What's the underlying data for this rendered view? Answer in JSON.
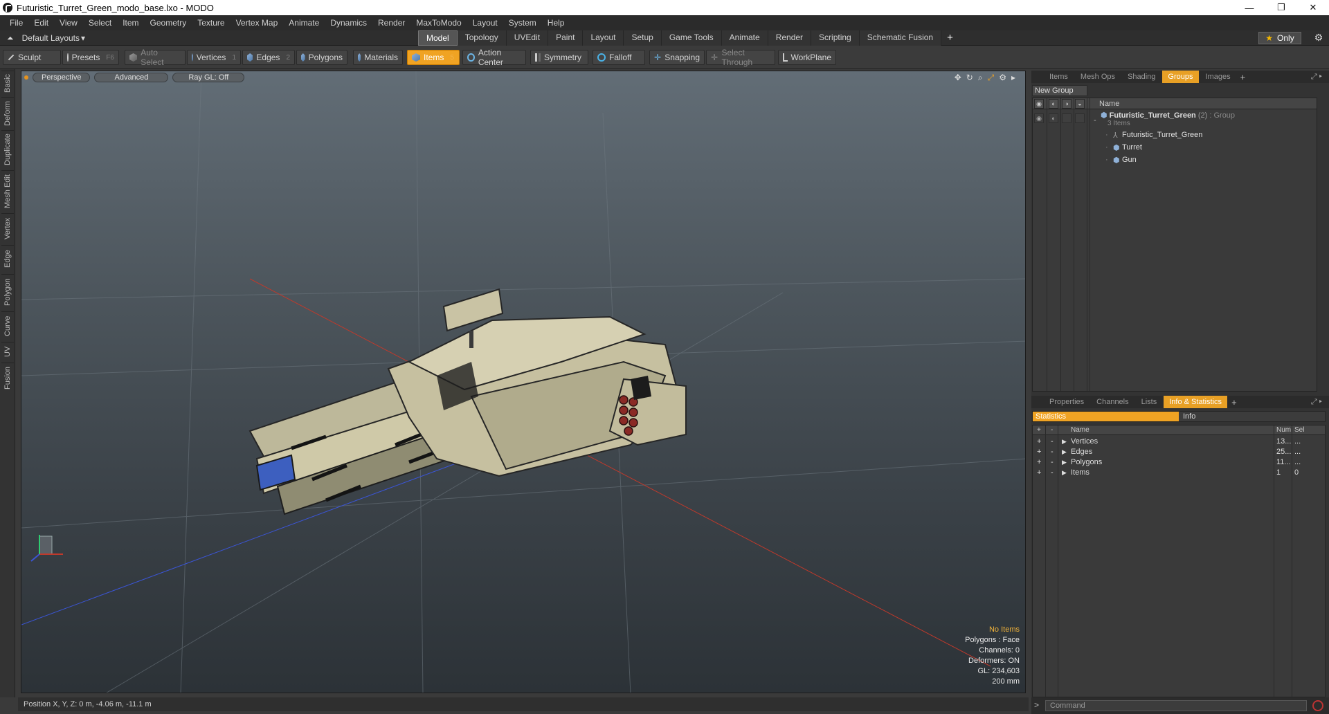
{
  "window": {
    "title": "Futuristic_Turret_Green_modo_base.lxo - MODO",
    "controls": {
      "minimize": "—",
      "maximize": "❐",
      "close": "✕"
    }
  },
  "menubar": [
    "File",
    "Edit",
    "View",
    "Select",
    "Item",
    "Geometry",
    "Texture",
    "Vertex Map",
    "Animate",
    "Dynamics",
    "Render",
    "MaxToModo",
    "Layout",
    "System",
    "Help"
  ],
  "layoutbar": {
    "layout_label": "Default Layouts",
    "tabs": [
      "Model",
      "Topology",
      "UVEdit",
      "Paint",
      "Layout",
      "Setup",
      "Game Tools",
      "Animate",
      "Render",
      "Scripting",
      "Schematic Fusion"
    ],
    "active_tab": "Model",
    "add": "+",
    "only_label": "Only"
  },
  "toolbar": {
    "sculpt": "Sculpt",
    "presets": "Presets",
    "presets_key": "F6",
    "auto_select": "Auto Select",
    "vertices": "Vertices",
    "vertices_key": "1",
    "edges": "Edges",
    "edges_key": "2",
    "polygons": "Polygons",
    "materials": "Materials",
    "items": "Items",
    "items_key": "5",
    "action_center": "Action Center",
    "symmetry": "Symmetry",
    "falloff": "Falloff",
    "snapping": "Snapping",
    "select_through": "Select Through",
    "workplane": "WorkPlane"
  },
  "left_tabs": [
    "Basic",
    "Deform",
    "Duplicate",
    "Mesh Edit",
    "Vertex",
    "Edge",
    "Polygon",
    "Curve",
    "UV",
    "Fusion"
  ],
  "viewport": {
    "view_mode": "Perspective",
    "shading": "Advanced",
    "raygl": "Ray GL: Off",
    "info": {
      "no_items": "No Items",
      "polygons": "Polygons : Face",
      "channels": "Channels: 0",
      "deformers": "Deformers: ON",
      "gl": "GL: 234,603",
      "scale": "200 mm"
    }
  },
  "status": {
    "position": "Position X, Y, Z:  0 m, -4.06 m, -11.1 m"
  },
  "groups_panel": {
    "tabs": [
      "Items",
      "Mesh Ops",
      "Shading",
      "Groups",
      "Images"
    ],
    "active_tab": "Groups",
    "new_group": "New Group",
    "name_header": "Name",
    "group": {
      "name": "Futuristic_Turret_Green",
      "count": "(2)",
      "type": ": Group",
      "sub": "3 Items"
    },
    "children": [
      "Futuristic_Turret_Green",
      "Turret",
      "Gun"
    ]
  },
  "info_panel": {
    "tabs": [
      "Properties",
      "Channels",
      "Lists",
      "Info & Statistics"
    ],
    "active_tab": "Info & Statistics",
    "subtabs": {
      "statistics": "Statistics",
      "info": "Info"
    },
    "headers": {
      "name": "Name",
      "num": "Num",
      "sel": "Sel"
    },
    "rows": [
      {
        "name": "Vertices",
        "num": "13...",
        "sel": "..."
      },
      {
        "name": "Edges",
        "num": "25...",
        "sel": "..."
      },
      {
        "name": "Polygons",
        "num": "11...",
        "sel": "..."
      },
      {
        "name": "Items",
        "num": "1",
        "sel": "0"
      }
    ]
  },
  "command": {
    "placeholder": "Command"
  },
  "colors": {
    "accent": "#f0a323",
    "viewport_top": "#626d76",
    "viewport_bottom": "#2c3237",
    "x_axis": "#c0392b",
    "z_axis": "#3b55d6"
  }
}
